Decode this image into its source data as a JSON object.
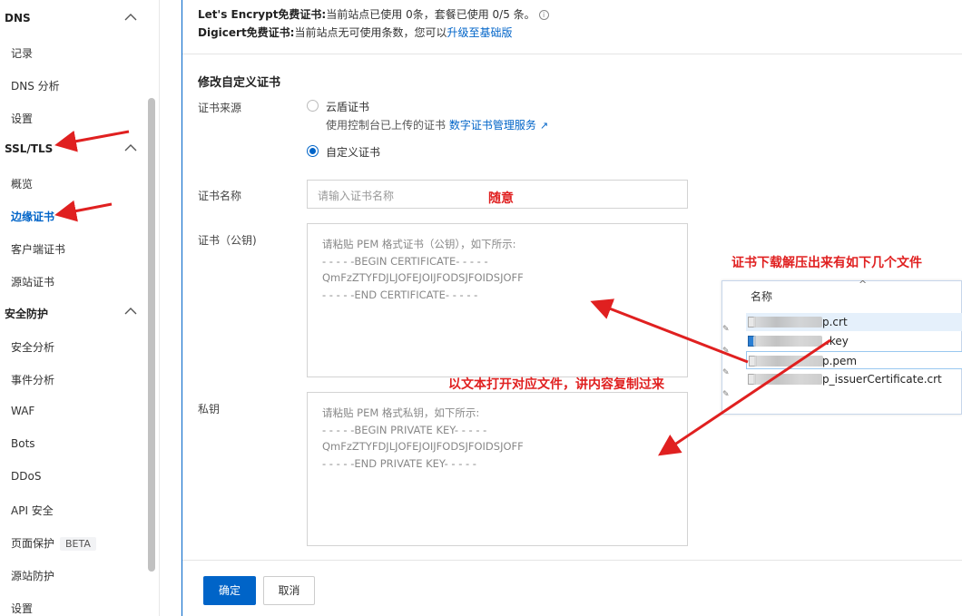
{
  "sidebar": {
    "groups": [
      {
        "label": "DNS",
        "items": [
          "记录",
          "DNS 分析",
          "设置"
        ]
      },
      {
        "label": "SSL/TLS",
        "items": [
          "概览",
          "边缘证书",
          "客户端证书",
          "源站证书"
        ]
      },
      {
        "label": "安全防护",
        "items": [
          "安全分析",
          "事件分析",
          "WAF",
          "Bots",
          "DDoS",
          "API 安全",
          "页面保护",
          "源站防护",
          "设置"
        ]
      }
    ],
    "beta_badge": "BETA",
    "active_item": "边缘证书"
  },
  "notices": {
    "letsencrypt_title": "Let's Encrypt免费证书:",
    "letsencrypt_text": "当前站点已使用 0条，套餐已使用 0/5 条。",
    "digicert_title": "Digicert免费证书:",
    "digicert_text": "当前站点无可使用条数，您可以",
    "digicert_link": "升级至基础版"
  },
  "form": {
    "section_title": "修改自定义证书",
    "source_label": "证书来源",
    "radio_cloud": "云盾证书",
    "radio_cloud_desc": "使用控制台已上传的证书",
    "radio_cloud_link": "数字证书管理服务",
    "radio_custom": "自定义证书",
    "selected_source": "自定义证书",
    "name_label": "证书名称",
    "name_placeholder": "请输入证书名称",
    "cert_label": "证书（公钥)",
    "cert_placeholder": "请粘贴 PEM 格式证书（公钥），如下所示:\n- - - - -BEGIN CERTIFICATE- - - - -\nQmFzZTYFDJLJOFEJOIJFODSJFOIDSJOFF\n- - - - -END CERTIFICATE- - - - -",
    "key_label": "私钥",
    "key_placeholder": "请粘贴 PEM 格式私钥，如下所示:\n- - - - -BEGIN PRIVATE KEY- - - - -\nQmFzZTYFDJLJOFEJOIJFODSJFOIDSJOFF\n- - - - -END PRIVATE KEY- - - - -",
    "ok_button": "确定",
    "cancel_button": "取消"
  },
  "annotations": {
    "random": "随意",
    "files_note": "证书下载解压出来有如下几个文件",
    "copy_note": "以文本打开对应文件，讲内容复制过来"
  },
  "explorer": {
    "column_header": "名称",
    "files": [
      {
        "suffix": "p.crt"
      },
      {
        "suffix": ".key"
      },
      {
        "suffix": "p.pem"
      },
      {
        "suffix": "p_issuerCertificate.crt"
      }
    ]
  },
  "colors": {
    "accent": "#0064c8",
    "annotation": "#e02020"
  }
}
